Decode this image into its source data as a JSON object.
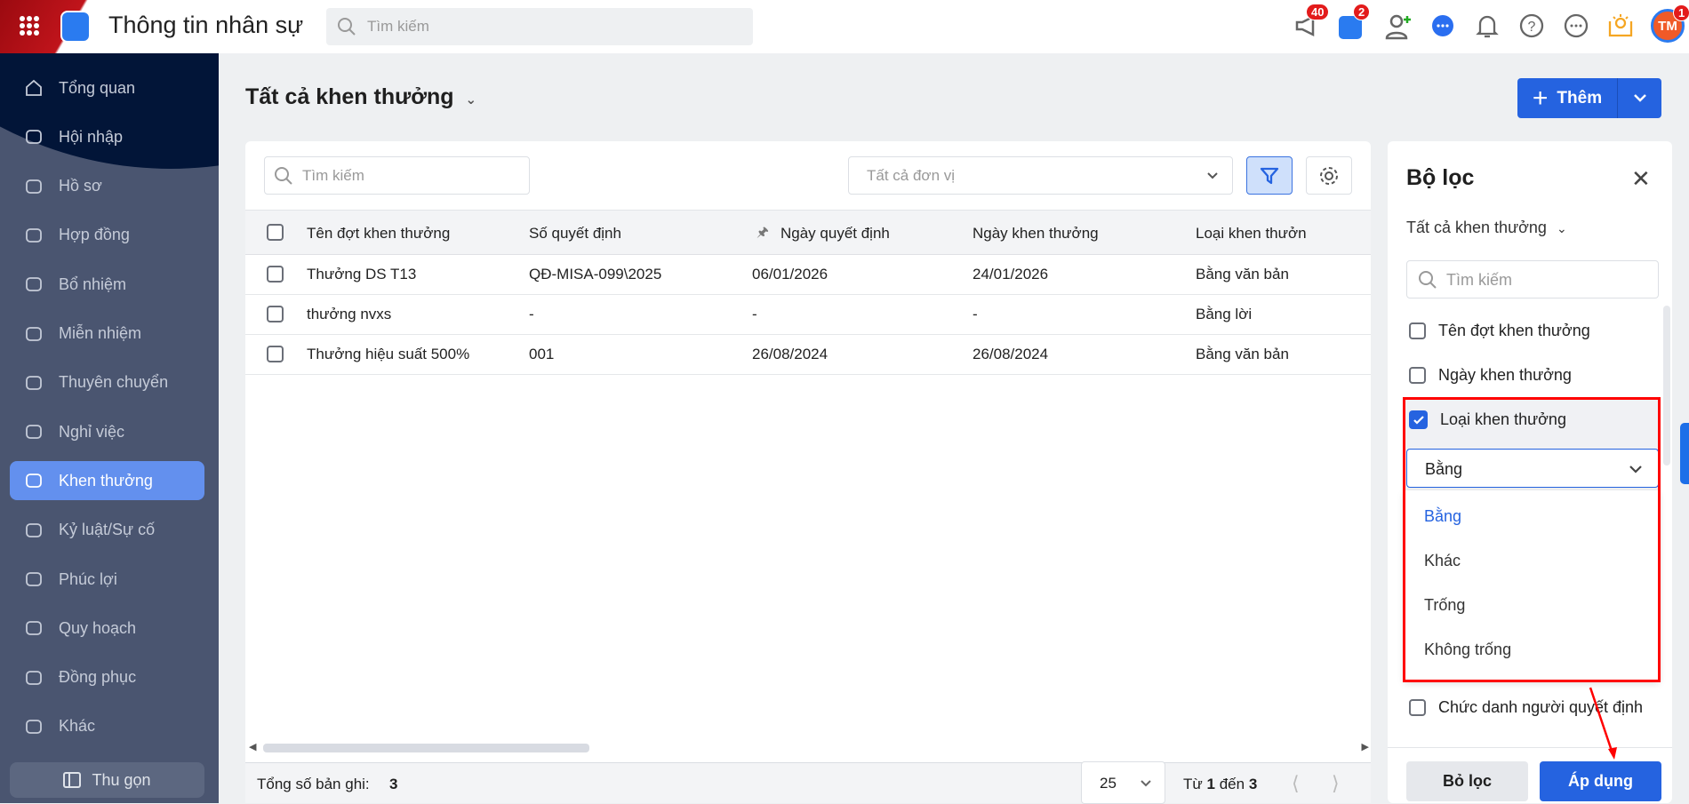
{
  "app": {
    "title": "Thông tin nhân sự",
    "search_placeholder": "Tìm kiếm"
  },
  "topbar": {
    "icons": [
      {
        "name": "megaphone-icon",
        "badge": "40"
      },
      {
        "name": "cart-icon",
        "badge": "2"
      },
      {
        "name": "add-user-icon"
      },
      {
        "name": "chat-icon"
      },
      {
        "name": "bell-icon"
      },
      {
        "name": "help-icon"
      },
      {
        "name": "more-icon"
      },
      {
        "name": "idea-icon"
      }
    ],
    "avatar": {
      "initials": "TM",
      "badge": "1"
    }
  },
  "sidebar": {
    "items": [
      {
        "label": "Tổng quan",
        "icon": "home-icon"
      },
      {
        "label": "Hội nhập",
        "icon": "team-icon"
      },
      {
        "label": "Hồ sơ",
        "icon": "user-icon"
      },
      {
        "label": "Hợp đồng",
        "icon": "contract-icon"
      },
      {
        "label": "Bổ nhiệm",
        "icon": "user-plus-icon"
      },
      {
        "label": "Miễn nhiệm",
        "icon": "user-minus-icon"
      },
      {
        "label": "Thuyên chuyển",
        "icon": "transfer-icon"
      },
      {
        "label": "Nghỉ việc",
        "icon": "user-x-icon"
      },
      {
        "label": "Khen thưởng",
        "icon": "ticket-star-icon",
        "active": true
      },
      {
        "label": "Kỷ luật/Sự cố",
        "icon": "shield-x-icon"
      },
      {
        "label": "Phúc lợi",
        "icon": "benefit-icon"
      },
      {
        "label": "Quy hoạch",
        "icon": "users-icon"
      },
      {
        "label": "Đồng phục",
        "icon": "shirt-icon"
      },
      {
        "label": "Khác",
        "icon": "dots-icon"
      }
    ],
    "collapse_label": "Thu gọn"
  },
  "main": {
    "title": "Tất cả khen thưởng",
    "add_label": "Thêm",
    "search_placeholder": "Tìm kiếm",
    "unit_placeholder": "Tất cả đơn vị",
    "columns": [
      "Tên đợt khen thưởng",
      "Số quyết định",
      "Ngày quyết định",
      "Ngày khen thưởng",
      "Loại khen thưởn"
    ],
    "rows": [
      [
        "Thưởng DS T13",
        "QĐ-MISA-099\\2025",
        "06/01/2026",
        "24/01/2026",
        "Bằng văn bản"
      ],
      [
        "thưởng nvxs",
        "-",
        "-",
        "-",
        "Bằng lời"
      ],
      [
        "Thưởng hiệu suất 500%",
        "001",
        "26/08/2024",
        "26/08/2024",
        "Bằng văn bản"
      ]
    ],
    "footer": {
      "total_label": "Tổng số bản ghi:",
      "total": "3",
      "page_size": "25",
      "range_prefix": "Từ",
      "range_from": "1",
      "range_mid": "đến",
      "range_to": "3"
    }
  },
  "filter": {
    "title": "Bộ lọc",
    "scope": "Tất cả khen thưởng",
    "search_placeholder": "Tìm kiếm",
    "fields": [
      {
        "label": "Tên đợt khen thưởng",
        "checked": false
      },
      {
        "label": "Ngày khen thưởng",
        "checked": false
      },
      {
        "label": "Loại khen thưởng",
        "checked": true
      },
      {
        "label": "Chức danh người quyết định",
        "checked": false
      }
    ],
    "operator_value": "Bằng",
    "operator_options": [
      "Bằng",
      "Khác",
      "Trống",
      "Không trống"
    ],
    "clear_label": "Bỏ lọc",
    "apply_label": "Áp dụng"
  },
  "colors": {
    "primary": "#2563e0",
    "sidebar": "#4a5570",
    "active": "#6390ee",
    "highlight": "#ff0000"
  }
}
